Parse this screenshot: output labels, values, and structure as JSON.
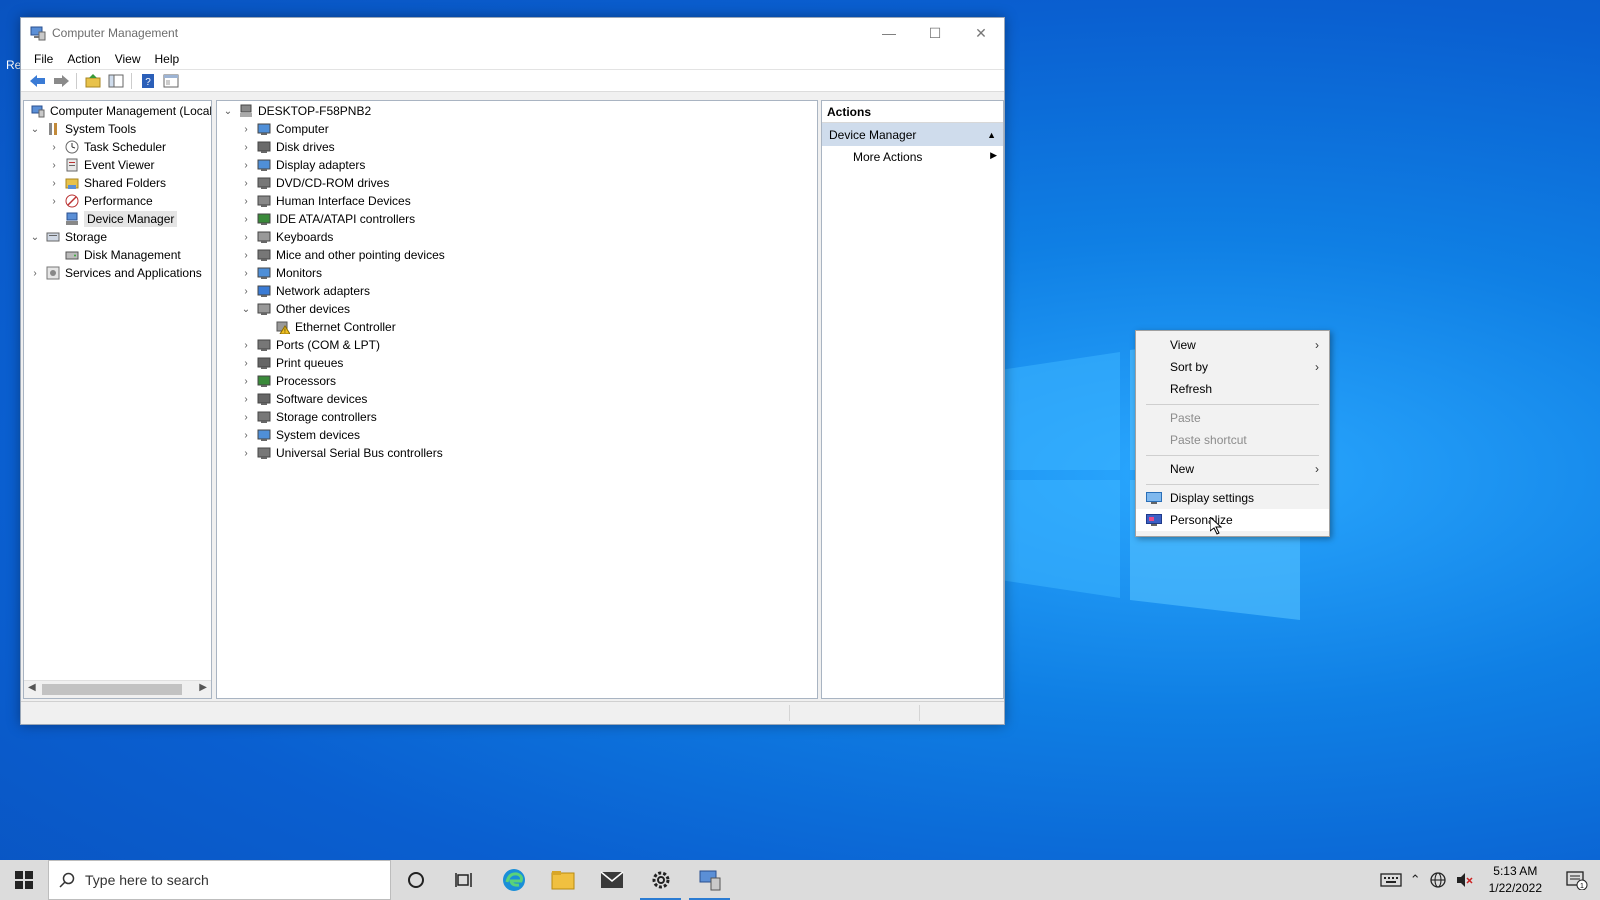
{
  "window": {
    "title": "Computer Management",
    "menu": [
      "File",
      "Action",
      "View",
      "Help"
    ]
  },
  "left_tree": [
    {
      "label": "Computer Management (Local",
      "name": "tree-computer-management"
    },
    {
      "label": "System Tools",
      "name": "tree-system-tools"
    },
    {
      "label": "Task Scheduler",
      "name": "tree-task-scheduler"
    },
    {
      "label": "Event Viewer",
      "name": "tree-event-viewer"
    },
    {
      "label": "Shared Folders",
      "name": "tree-shared-folders"
    },
    {
      "label": "Performance",
      "name": "tree-performance"
    },
    {
      "label": "Device Manager",
      "name": "tree-device-manager"
    },
    {
      "label": "Storage",
      "name": "tree-storage"
    },
    {
      "label": "Disk Management",
      "name": "tree-disk-management"
    },
    {
      "label": "Services and Applications",
      "name": "tree-services-applications"
    }
  ],
  "device_tree": {
    "root": "DESKTOP-F58PNB2",
    "items": [
      "Computer",
      "Disk drives",
      "Display adapters",
      "DVD/CD-ROM drives",
      "Human Interface Devices",
      "IDE ATA/ATAPI controllers",
      "Keyboards",
      "Mice and other pointing devices",
      "Monitors",
      "Network adapters",
      "Other devices",
      "Ethernet Controller",
      "Ports (COM & LPT)",
      "Print queues",
      "Processors",
      "Software devices",
      "Storage controllers",
      "System devices",
      "Universal Serial Bus controllers"
    ]
  },
  "actions": {
    "header": "Actions",
    "group": "Device Manager",
    "more": "More Actions"
  },
  "context_menu": {
    "view": "View",
    "sort_by": "Sort by",
    "refresh": "Refresh",
    "paste": "Paste",
    "paste_shortcut": "Paste shortcut",
    "new": "New",
    "display_settings": "Display settings",
    "personalize": "Personalize"
  },
  "taskbar": {
    "search_placeholder": "Type here to search",
    "time": "5:13 AM",
    "date": "1/22/2022",
    "notification_count": "1"
  },
  "desktop": {
    "icon_fragment": "Re"
  },
  "colors": {
    "accent": "#2b7cd3",
    "selection": "#cfdcec",
    "desktop": "#0a6fe0"
  }
}
